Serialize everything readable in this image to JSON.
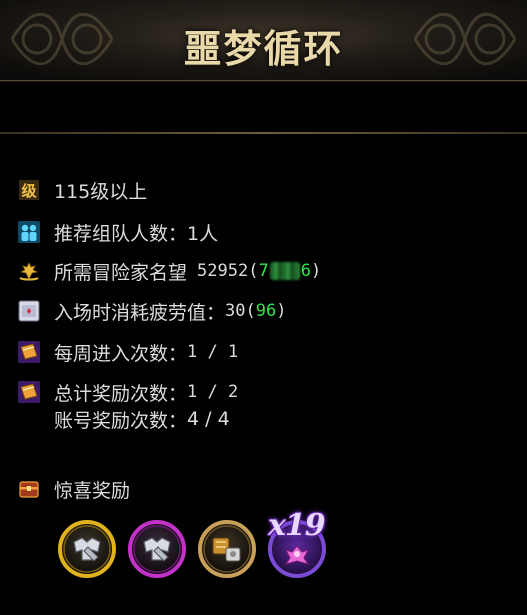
{
  "header": {
    "title": "噩梦循环"
  },
  "requirements": {
    "level": "115级以上",
    "party_label": "推荐组队人数",
    "party_sep": "：",
    "party_value": "1人",
    "renown_label": "所需冒险家名望",
    "renown_value": "52952",
    "renown_paren_open": "(",
    "renown_green_prefix": "7",
    "renown_green_suffix": "6",
    "renown_paren_close": ")",
    "fatigue_label": "入场时消耗疲劳值",
    "fatigue_sep": "：",
    "fatigue_value": "30",
    "fatigue_paren_open": "(",
    "fatigue_green": "96",
    "fatigue_paren_close": ")",
    "weekly_label": "每周进入次数",
    "weekly_sep": "：",
    "weekly_value": "1 / 1",
    "total_label": "总计奖励次数",
    "total_sep": "：",
    "total_value": "1 / 2",
    "account_label": "账号奖励次数",
    "account_sep": "：",
    "account_value": "4 / 4"
  },
  "surprise": {
    "label": "惊喜奖励",
    "items": [
      {
        "icon": "gold-armor-icon",
        "color": "#d9a616"
      },
      {
        "icon": "purple-armor-icon",
        "color": "#c232c9"
      },
      {
        "icon": "material-box-icon",
        "color": "#c8a05a"
      },
      {
        "icon": "purple-emblem-icon",
        "color": "#7b4bd6"
      }
    ],
    "count": "x19"
  },
  "colors": {
    "title": "#e9d8a8",
    "text": "#dcdcdc",
    "highlight": "#2ee84a"
  }
}
